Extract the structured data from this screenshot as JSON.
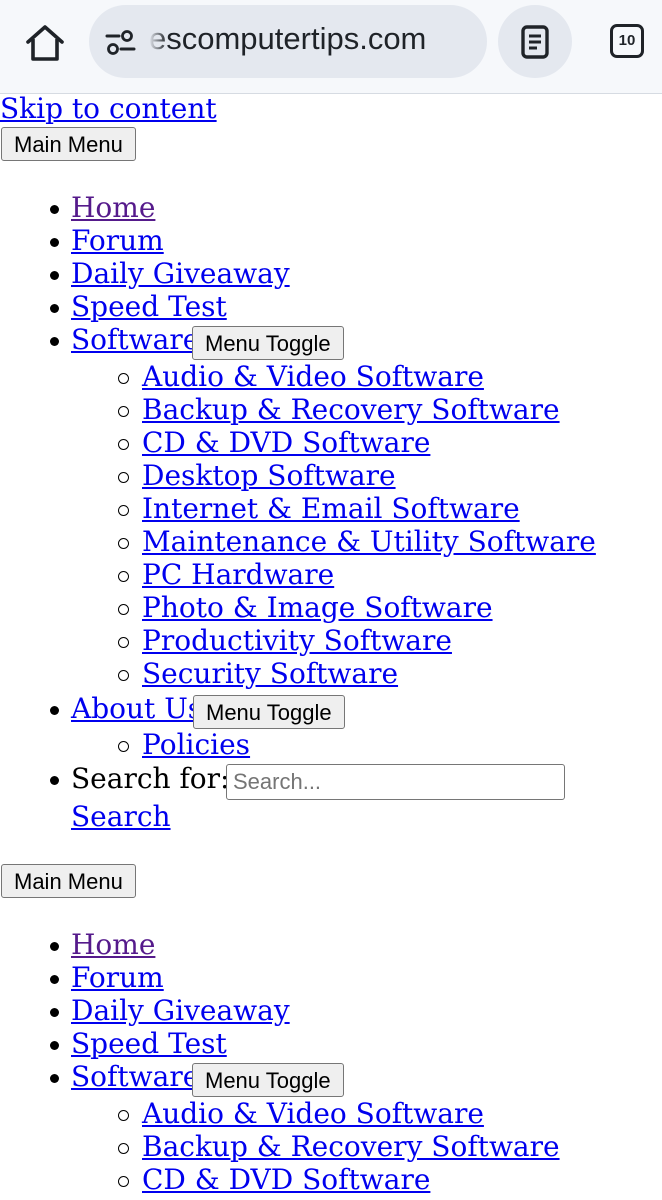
{
  "browser": {
    "url": "escomputertips.com",
    "tab_count": "10"
  },
  "page": {
    "skip_link": "Skip to content",
    "menu_button": "Main Menu",
    "toggle_label": "Menu Toggle",
    "nav": {
      "home": "Home",
      "forum": "Forum",
      "giveaway": "Daily Giveaway",
      "speedtest": "Speed Test",
      "software": "Software",
      "software_sub": [
        "Audio & Video Software",
        "Backup & Recovery Software",
        "CD & DVD Software",
        "Desktop Software",
        "Internet & Email Software",
        "Maintenance & Utility Software",
        "PC Hardware",
        "Photo & Image Software",
        "Productivity Software",
        "Security Software"
      ],
      "about": "About Us",
      "about_sub": [
        "Policies"
      ],
      "search_label": "Search for:",
      "search_placeholder": "Search...",
      "search_button": "Search"
    }
  }
}
